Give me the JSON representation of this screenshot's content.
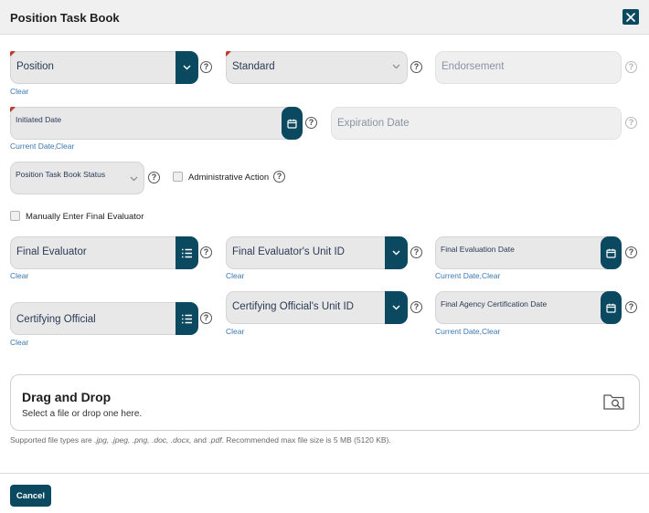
{
  "dialog": {
    "title": "Position Task Book",
    "close_icon": "close-icon"
  },
  "fields": {
    "position": {
      "label": "Position",
      "link": "Clear"
    },
    "standard": {
      "label": "Standard"
    },
    "endorsement": {
      "label": "Endorsement"
    },
    "initiated_date": {
      "label": "Initiated Date",
      "link_current": "Current Date,",
      "link_clear": "Clear"
    },
    "expiration_date": {
      "label": "Expiration Date"
    },
    "ptb_status": {
      "label": "Position Task Book Status"
    },
    "administrative_action": {
      "label": "Administrative Action"
    },
    "manual_evaluator": {
      "label": "Manually Enter Final Evaluator"
    },
    "final_evaluator": {
      "label": "Final Evaluator",
      "link": "Clear"
    },
    "final_evaluator_unit": {
      "label": "Final Evaluator's Unit ID",
      "link": "Clear"
    },
    "final_evaluation_date": {
      "label": "Final Evaluation Date",
      "link_current": "Current Date,",
      "link_clear": "Clear"
    },
    "certifying_official": {
      "label": "Certifying Official",
      "link": "Clear"
    },
    "certifying_official_unit": {
      "label": "Certifying Official's Unit ID",
      "link": "Clear"
    },
    "final_agency_cert_date": {
      "label": "Final Agency Certification Date",
      "link_current": "Current Date,",
      "link_clear": "Clear"
    }
  },
  "help_glyph": "?",
  "dropzone": {
    "title": "Drag and Drop",
    "subtitle": "Select a file or drop one here.",
    "icon": "folder-search-icon"
  },
  "note": {
    "prefix": "Supported file types are ",
    "types": ".jpg, .jpeg, .png, .doc, .docx,",
    "and": " and ",
    "last_type": ".pdf",
    "suffix": ". Recommended max file size is 5 MB (5120 KB)."
  },
  "footer": {
    "cancel_label": "Cancel"
  },
  "colors": {
    "accent": "#0a4960",
    "required_marker": "#c0392b",
    "link": "#3a78b5"
  }
}
